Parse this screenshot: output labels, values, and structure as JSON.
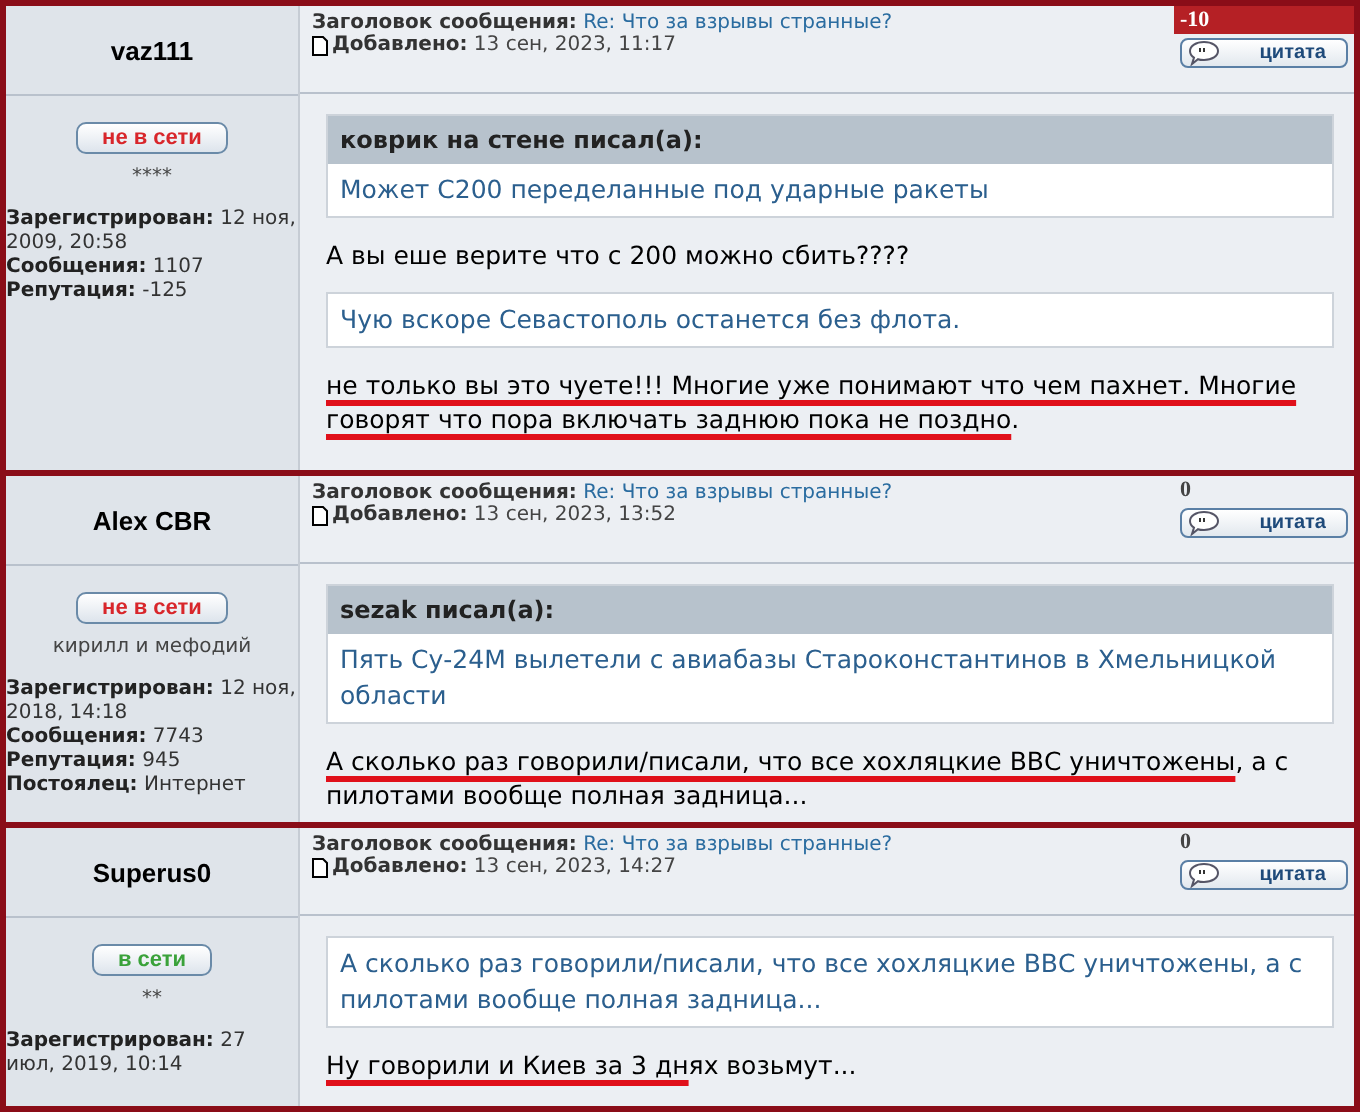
{
  "posts": [
    {
      "author": "vaz111",
      "status": {
        "label": "не в сети",
        "online": false
      },
      "rank": "****",
      "details": [
        {
          "label": "Зарегистрирован:",
          "value": "12 ноя, 2009, 20:58"
        },
        {
          "label": "Сообщения:",
          "value": "1107"
        },
        {
          "label": "Репутация:",
          "value": "-125"
        }
      ],
      "subject_label": "Заголовок сообщения:",
      "subject": "Re: Что за взрывы странные?",
      "posted_label": "Добавлено:",
      "posted": "13 сен, 2023, 11:17",
      "rating": {
        "value": "-10",
        "negative": true
      },
      "quote_button": "цитата",
      "body": [
        {
          "kind": "quote",
          "header": "коврик на стене писал(а):",
          "text": "Может С200 переделанные под ударные ракеты"
        },
        {
          "kind": "paragraph",
          "segments": [
            {
              "text": "А вы еше верите что с 200 можно сбить????",
              "underlined": false
            }
          ]
        },
        {
          "kind": "quote",
          "text": "Чую вскоре Севастополь останется без флота."
        },
        {
          "kind": "paragraph",
          "segments": [
            {
              "text": "не только вы это чуете!!! Многие уже понимают что чем пахнет. Многие говорят что пора включать заднюю пока не поздно",
              "underlined": true
            },
            {
              "text": ".",
              "underlined": false
            }
          ]
        }
      ]
    },
    {
      "author": "Alex CBR",
      "status": {
        "label": "не в сети",
        "online": false
      },
      "rank": "кирилл и мефодий",
      "details": [
        {
          "label": "Зарегистрирован:",
          "value": "12 ноя, 2018, 14:18"
        },
        {
          "label": "Сообщения:",
          "value": "7743"
        },
        {
          "label": "Репутация:",
          "value": "945"
        },
        {
          "label": "Постоялец:",
          "value": "Интернет"
        }
      ],
      "subject_label": "Заголовок сообщения:",
      "subject": "Re: Что за взрывы странные?",
      "posted_label": "Добавлено:",
      "posted": "13 сен, 2023, 13:52",
      "rating": {
        "value": "0",
        "negative": false
      },
      "quote_button": "цитата",
      "body": [
        {
          "kind": "quote",
          "header": "sezak писал(а):",
          "text": "Пять Су-24М вылетели с авиабазы Староконстантинов в Хмельницкой области"
        },
        {
          "kind": "paragraph",
          "segments": [
            {
              "text": "А сколько раз говорили/писали, что все хохляцкие ВВС уничтожены",
              "underlined": true
            },
            {
              "text": ", а с пилотами вообще полная задница...",
              "underlined": false
            }
          ]
        }
      ]
    },
    {
      "author": "Superus0",
      "status": {
        "label": "в сети",
        "online": true
      },
      "rank": "**",
      "details": [
        {
          "label": "Зарегистрирован:",
          "value": "27 июл, 2019, 10:14"
        }
      ],
      "subject_label": "Заголовок сообщения:",
      "subject": "Re: Что за взрывы странные?",
      "posted_label": "Добавлено:",
      "posted": "13 сен, 2023, 14:27",
      "rating": {
        "value": "0",
        "negative": false
      },
      "quote_button": "цитата",
      "body": [
        {
          "kind": "quote",
          "text": "А сколько раз говорили/писали, что все хохляцкие ВВС уничтожены, а с пилотами вообще полная задница..."
        },
        {
          "kind": "paragraph",
          "segments": [
            {
              "text": "Ну говорили и Киев за 3 дн",
              "underlined": true
            },
            {
              "text": "ях возьмут...",
              "underlined": false
            }
          ]
        }
      ]
    }
  ]
}
